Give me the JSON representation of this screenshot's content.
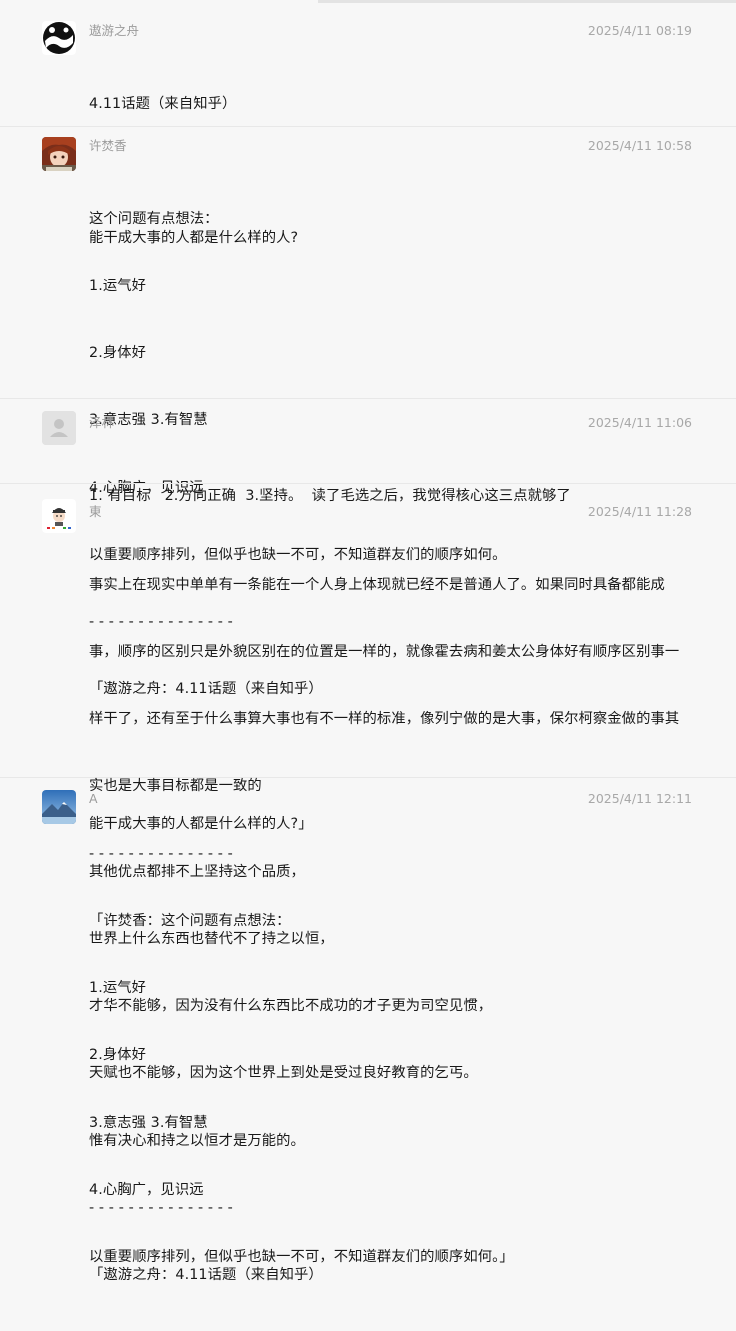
{
  "messages": [
    {
      "name": "遨游之舟",
      "time": "2025/4/11 08:19",
      "avatar": "panda-avatar",
      "lines": [
        "4.11话题（来自知乎）",
        "",
        "能干成大事的人都是什么样的人?"
      ]
    },
    {
      "name": "许焚香",
      "time": "2025/4/11 10:58",
      "avatar": "anime-avatar",
      "lines": [
        "这个问题有点想法：",
        "1.运气好",
        "2.身体好",
        "3.意志强 3.有智慧",
        "4.心胸广，见识远",
        "以重要顺序排列，但似乎也缺一不可，不知道群友们的顺序如何。",
        "- - - - - - - - - - - - - - -",
        "「遨游之舟：4.11话题（来自知乎）",
        "",
        "能干成大事的人都是什么样的人?」"
      ]
    },
    {
      "name": "泽林",
      "time": "2025/4/11 11:06",
      "avatar": "default-user-avatar",
      "lines": [
        "1. 有目标   2.方向正确  3.坚持。  读了毛选之后，我觉得核心这三点就够了"
      ]
    },
    {
      "name": "東",
      "time": "2025/4/11 11:28",
      "avatar": "cartoon-avatar",
      "lines": [
        "事实上在现实中单单有一条能在一个人身上体现就已经不是普通人了。如果同时具备都能成",
        "事，顺序的区别只是外貌区别在的位置是一样的，就像霍去病和姜太公身体好有顺序区别事一",
        "样干了，还有至于什么事算大事也有不一样的标准，像列宁做的是大事，保尔柯察金做的事其",
        "实也是大事目标都是一致的",
        "- - - - - - - - - - - - - - -",
        "「许焚香：这个问题有点想法：",
        "1.运气好",
        "2.身体好",
        "3.意志强 3.有智慧",
        "4.心胸广，见识远",
        "以重要顺序排列，但似乎也缺一不可，不知道群友们的顺序如何。」"
      ]
    },
    {
      "name": "A",
      "time": "2025/4/11 12:11",
      "avatar": "mountain-avatar",
      "lines": [
        "其他优点都排不上坚持这个品质，",
        "世界上什么东西也替代不了持之以恒，",
        "才华不能够，因为没有什么东西比不成功的才子更为司空见惯，",
        "天赋也不能够，因为这个世界上到处是受过良好教育的乞丐。",
        "惟有决心和持之以恒才是万能的。",
        "- - - - - - - - - - - - - - -",
        "「遨游之舟：4.11话题（来自知乎）"
      ]
    }
  ]
}
